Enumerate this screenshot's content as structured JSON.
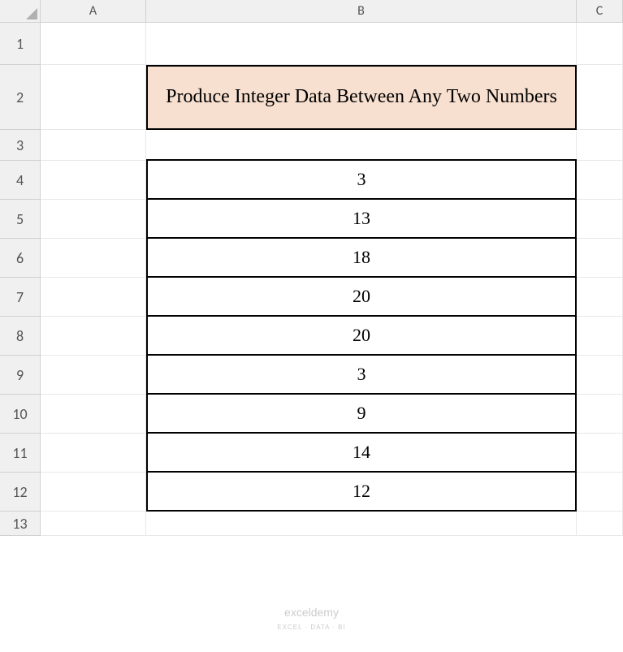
{
  "columns": [
    "A",
    "B",
    "C"
  ],
  "rows": [
    "1",
    "2",
    "3",
    "4",
    "5",
    "6",
    "7",
    "8",
    "9",
    "10",
    "11",
    "12",
    "13"
  ],
  "title": "Produce Integer Data Between Any Two Numbers",
  "data": [
    "3",
    "13",
    "18",
    "20",
    "20",
    "3",
    "9",
    "14",
    "12"
  ],
  "watermark": {
    "main": "exceldemy",
    "sub": "EXCEL · DATA · BI"
  }
}
